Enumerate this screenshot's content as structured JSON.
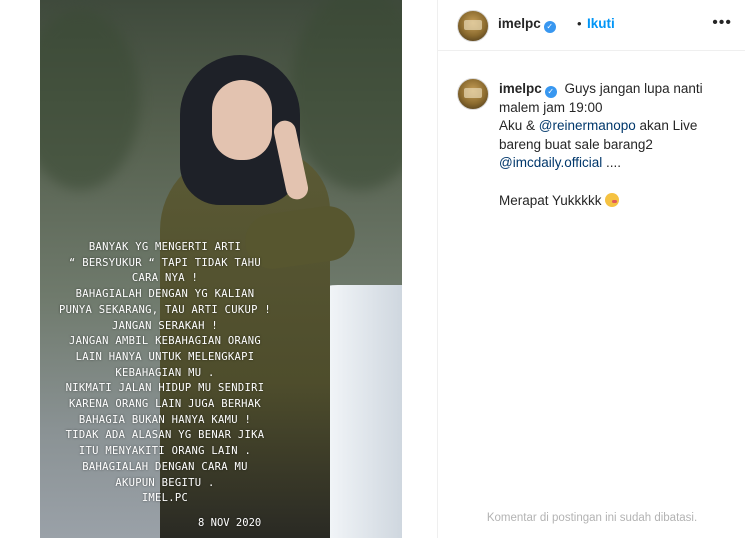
{
  "post": {
    "username": "imelpc",
    "follow_label": "Ikuti",
    "separator": "•",
    "more_label": "•••"
  },
  "story": {
    "caption_lines": [
      "BANYAK YG MENGERTI ARTI",
      "“ BERSYUKUR “ TAPI TIDAK TAHU",
      "CARA NYA !",
      "BAHAGIALAH DENGAN YG KALIAN",
      "PUNYA SEKARANG, TAU ARTI CUKUP !",
      "JANGAN SERAKAH !",
      "JANGAN AMBIL KEBAHAGIAN ORANG",
      "LAIN HANYA UNTUK MELENGKAPI",
      "KEBAHAGIAN MU .",
      "NIKMATI JALAN HIDUP MU SENDIRI",
      "KARENA ORANG LAIN JUGA BERHAK",
      "BAHAGIA BUKAN HANYA KAMU !",
      "TIDAK ADA ALASAN YG BENAR JIKA",
      "ITU MENYAKITI ORANG LAIN .",
      "BAHAGIALAH DENGAN CARA MU",
      "AKUPUN BEGITU .",
      "IMEL.PC"
    ],
    "date": "8 NOV 2020"
  },
  "caption": {
    "username": "imelpc",
    "line1": "Guys jangan lupa nanti malem jam 19:00",
    "line2_prefix": "Aku & ",
    "mention1": "@reinermanopo",
    "line2_suffix": " akan Live bareng buat sale barang2",
    "mention2": "@imcdaily.official",
    "line3_suffix": " ....",
    "line4": "Merapat Yukkkkk"
  },
  "footer": {
    "comments_disabled": "Komentar di postingan ini sudah dibatasi."
  },
  "colors": {
    "accent": "#0095f6",
    "mention": "#00376b",
    "verified": "#3897f0"
  }
}
